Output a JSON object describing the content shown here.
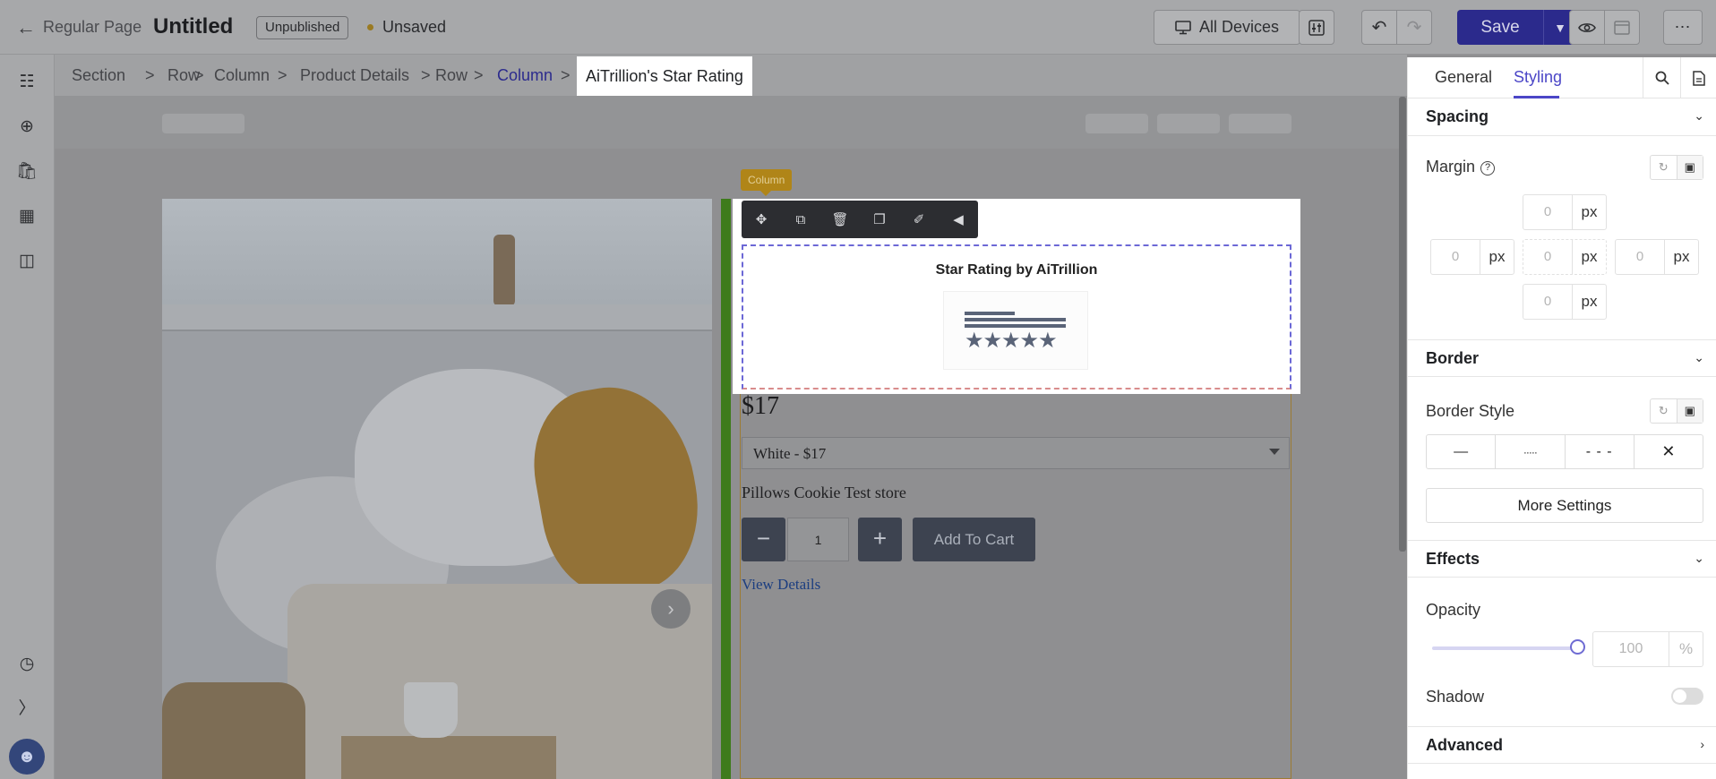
{
  "topbar": {
    "back_page": "Regular Page",
    "title": "Untitled",
    "status_badge": "Unpublished",
    "save_state": "Unsaved",
    "devices_label": "All Devices",
    "save_label": "Save"
  },
  "breadcrumb": {
    "items": [
      "Section",
      "Row",
      "Column",
      "Product Details",
      "Row",
      "Column"
    ],
    "current": "AiTrillion's Star Rating"
  },
  "canvas": {
    "column_tag": "Column",
    "rating_title": "Star Rating by AiTrillion",
    "price": "$17",
    "variant": "White - $17",
    "store": "Pillows Cookie Test store",
    "quantity": "1",
    "add_to_cart": "Add To Cart",
    "view_details": "View Details"
  },
  "panel": {
    "tabs": [
      "General",
      "Styling"
    ],
    "active_tab": "Styling",
    "spacing": {
      "title": "Spacing",
      "margin_label": "Margin",
      "unit": "px",
      "top": "0",
      "left": "0",
      "center": "0",
      "right": "0",
      "bottom": "0"
    },
    "border": {
      "title": "Border",
      "style_label": "Border Style",
      "more_settings": "More Settings"
    },
    "effects": {
      "title": "Effects",
      "opacity_label": "Opacity",
      "opacity_value": "100",
      "opacity_unit": "%",
      "opacity_level_percent": 100,
      "shadow_label": "Shadow",
      "shadow_on": false
    },
    "advanced": {
      "title": "Advanced"
    }
  },
  "colors": {
    "accent": "#4b46c7",
    "save_button": "#2b2a8c",
    "column_tag": "#b08518",
    "column_bar": "#3e7b1c"
  }
}
